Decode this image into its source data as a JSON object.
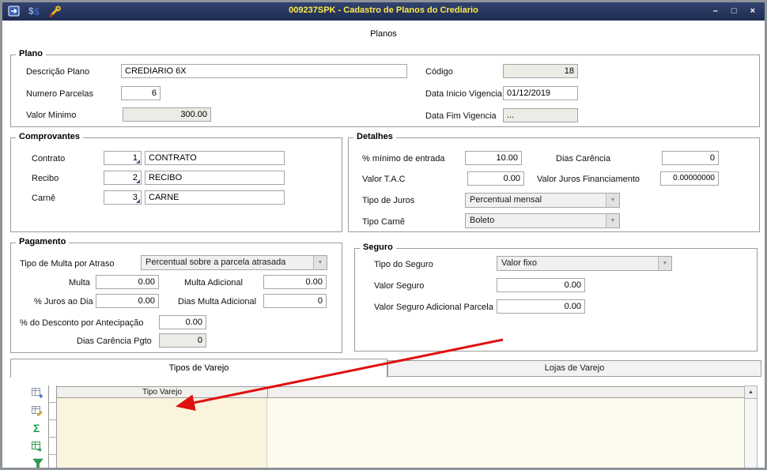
{
  "window": {
    "title": "009237SPK - Cadastro de Planos do Crediario",
    "controls": {
      "minimize": "–",
      "maximize": "□",
      "close": "×"
    }
  },
  "page": {
    "subtitle": "Planos"
  },
  "plano": {
    "legend": "Plano",
    "descricao": {
      "label": "Descrição Plano",
      "value": "CREDIARIO 6X"
    },
    "codigo": {
      "label": "Código",
      "value": "18"
    },
    "parcelas": {
      "label": "Numero Parcelas",
      "value": "6"
    },
    "inicio": {
      "label": "Data Inicio Vigencia",
      "value": "01/12/2019"
    },
    "minimo": {
      "label": "Valor Minimo",
      "value": "300.00"
    },
    "fim": {
      "label": "Data Fim Vigencia",
      "value": "..."
    }
  },
  "comprovantes": {
    "legend": "Comprovantes",
    "rows": [
      {
        "label": "Contrato",
        "code": "1",
        "name": "CONTRATO"
      },
      {
        "label": "Recibo",
        "code": "2",
        "name": "RECIBO"
      },
      {
        "label": "Carnê",
        "code": "3",
        "name": "CARNE"
      }
    ]
  },
  "detalhes": {
    "legend": "Detalhes",
    "entrada": {
      "label": "% mínimo de entrada",
      "value": "10.00"
    },
    "dias_carencia": {
      "label": "Dias Carência",
      "value": "0"
    },
    "tac": {
      "label": "Valor T.A.C",
      "value": "0.00"
    },
    "juros_financiamento": {
      "label": "Valor Juros Financiamento",
      "value": "0.00000000"
    },
    "tipo_juros": {
      "label": "Tipo de Juros",
      "value": "Percentual mensal"
    },
    "tipo_carne": {
      "label": "Tipo Carnê",
      "value": "Boleto"
    }
  },
  "pagamento": {
    "legend": "Pagamento",
    "tipo_multa": {
      "label": "Tipo de Multa por Atraso",
      "value": "Percentual sobre a parcela atrasada"
    },
    "multa": {
      "label": "Multa",
      "value": "0.00"
    },
    "multa_adicional": {
      "label": "Multa Adicional",
      "value": "0.00"
    },
    "juros_dia": {
      "label": "% Juros ao Dia",
      "value": "0.00"
    },
    "dias_multa_adicional": {
      "label": "Dias Multa Adicional",
      "value": "0"
    },
    "desconto_antecipacao": {
      "label": "% do Desconto por Antecipação",
      "value": "0.00"
    },
    "dias_carencia_pgto": {
      "label": "Dias Carência Pgto",
      "value": "0"
    }
  },
  "seguro": {
    "legend": "Seguro",
    "tipo": {
      "label": "Tipo do Seguro",
      "value": "Valor fixo"
    },
    "valor": {
      "label": "Valor Seguro",
      "value": "0.00"
    },
    "adicional": {
      "label": "Valor Seguro Adicional Parcela",
      "value": "0.00"
    }
  },
  "tabs": {
    "active": "Tipos de Varejo",
    "inactive": "Lojas de Varejo"
  },
  "grid": {
    "header": "Tipo Varejo",
    "sigma": "Σ",
    "scroll_up": "▲"
  },
  "icons": {
    "dropdown_arrow": "▼"
  },
  "colors": {
    "titlebar": "#24355e",
    "title_text": "#ffe94d",
    "grid_body": "#FBF7E4",
    "arrow": "#e01010"
  }
}
